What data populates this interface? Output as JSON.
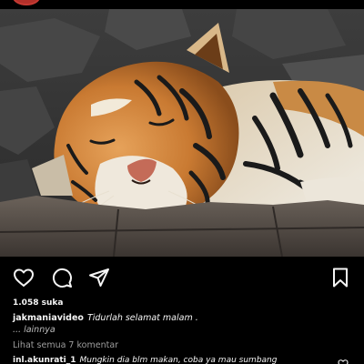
{
  "post": {
    "likes": "1.058 suka",
    "caption_user": "jakmaniavideo",
    "caption_text": "Tidurlah selamat malam .",
    "caption_more": "... lainnya",
    "view_comments": "Lihat semua 7 komentar",
    "comment": {
      "user": "inl.akunrati_1",
      "text": "Mungkin dia blm makan, coba ya mau sumbang"
    }
  },
  "icons": {
    "like": "heart-icon",
    "comment": "comment-bubble-icon",
    "share": "paper-plane-icon",
    "save": "bookmark-icon",
    "comment_like": "heart-icon"
  },
  "colors": {
    "background": "#000000",
    "text": "#f5f5f5",
    "muted": "#9e9e9e",
    "avatar": "#b3302a"
  }
}
